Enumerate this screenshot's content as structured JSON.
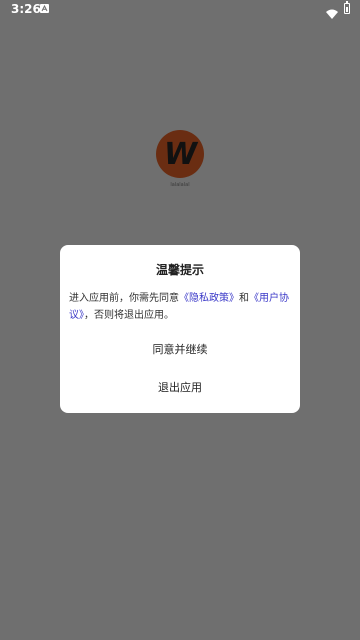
{
  "status_bar": {
    "time": "3:26"
  },
  "splash": {
    "logo_letter": "W",
    "app_name": "lalalalal",
    "logo_color": "#6a2d12"
  },
  "dialog": {
    "title": "温馨提示",
    "message_prefix": "进入应用前，你需先同意",
    "privacy_policy_link": "《隐私政策》",
    "message_and": "和",
    "user_agreement_link": "《用户协议》",
    "message_suffix": "，否则将退出应用。",
    "agree_button": "同意并继续",
    "exit_button": "退出应用",
    "link_color": "#3b39c8"
  }
}
